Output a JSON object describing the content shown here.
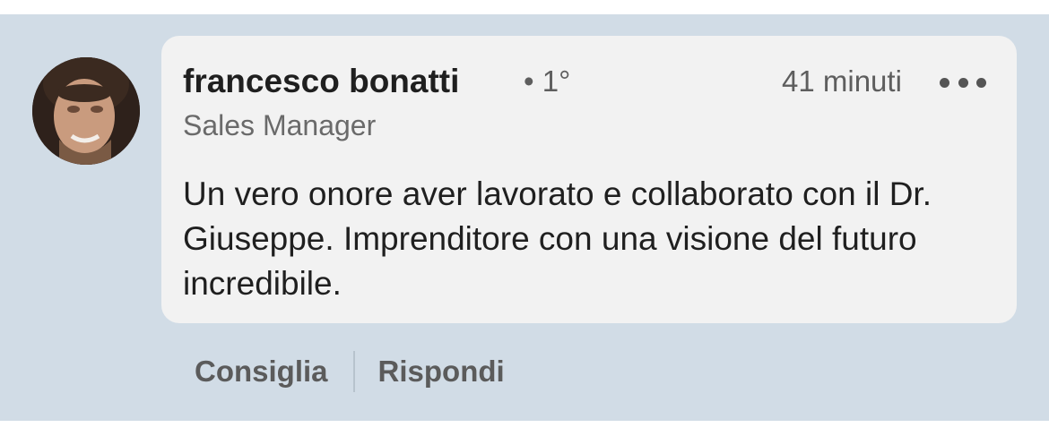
{
  "comment": {
    "author_name": "francesco bonatti",
    "connection_degree": "• 1°",
    "author_title": "Sales Manager",
    "timestamp": "41 minuti",
    "text": "Un vero onore aver lavorato e collaborato con il Dr. Giuseppe. Imprenditore con una visione del futuro incredibile.",
    "avatar_icon": "profile-photo",
    "more_icon": "more-horizontal-icon"
  },
  "actions": {
    "like_label": "Consiglia",
    "reply_label": "Rispondi"
  },
  "colors": {
    "background": "#d1dce6",
    "bubble": "#f2f2f2",
    "text_primary": "#1f1f1f",
    "text_secondary": "#5e5e5e"
  }
}
